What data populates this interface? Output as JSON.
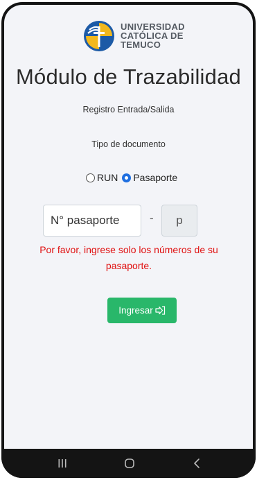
{
  "header": {
    "logo": {
      "icon": "ucm-logo-icon",
      "lines": [
        "UNIVERSIDAD",
        "CATÓLICA DE",
        "TEMUCO"
      ],
      "colors": {
        "blue": "#1c5aa6",
        "yellow": "#f2b81c"
      }
    },
    "title": "Módulo de Trazabilidad",
    "subtitle": "Registro Entrada/Salida"
  },
  "form": {
    "doc_type_label": "Tipo de documento",
    "radio_options": [
      {
        "label": "RUN",
        "checked": false
      },
      {
        "label": "Pasaporte",
        "checked": true
      }
    ],
    "passport_placeholder": "N° pasaporte",
    "dash": "-",
    "dv_placeholder": "p",
    "error_message": "Por favor, ingrese solo los números de su pasaporte.",
    "submit_label": "Ingresar",
    "submit_icon": "sign-in-icon"
  },
  "colors": {
    "accent_green": "#29b76a",
    "error_red": "#e01010",
    "radio_blue": "#1f6fe0",
    "background": "#f3f4f8"
  },
  "navbar": {
    "icons": [
      "recent-apps-icon",
      "home-icon",
      "back-icon"
    ]
  }
}
